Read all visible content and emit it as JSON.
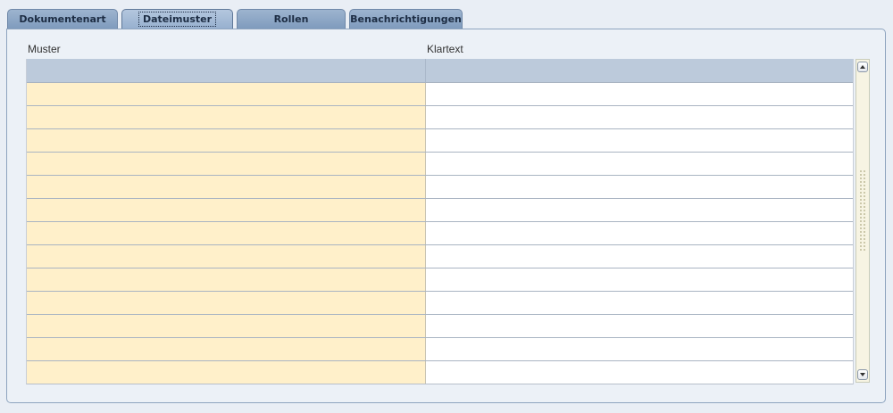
{
  "tabs": [
    {
      "label": "Dokumentenart",
      "active": false
    },
    {
      "label": "Dateimuster",
      "active": true
    },
    {
      "label": "Rollen",
      "active": false
    },
    {
      "label": "Benachrichtigungen",
      "active": false
    }
  ],
  "table": {
    "columns": [
      "Muster",
      "Klartext"
    ],
    "rows": [
      [
        "",
        ""
      ],
      [
        "",
        ""
      ],
      [
        "",
        ""
      ],
      [
        "",
        ""
      ],
      [
        "",
        ""
      ],
      [
        "",
        ""
      ],
      [
        "",
        ""
      ],
      [
        "",
        ""
      ],
      [
        "",
        ""
      ],
      [
        "",
        ""
      ],
      [
        "",
        ""
      ],
      [
        "",
        ""
      ],
      [
        "",
        ""
      ]
    ]
  },
  "colors": {
    "muster_column_bg": "#fff0ca",
    "header_bg": "#bccadb",
    "tab_bg": "#8fa9c8"
  }
}
